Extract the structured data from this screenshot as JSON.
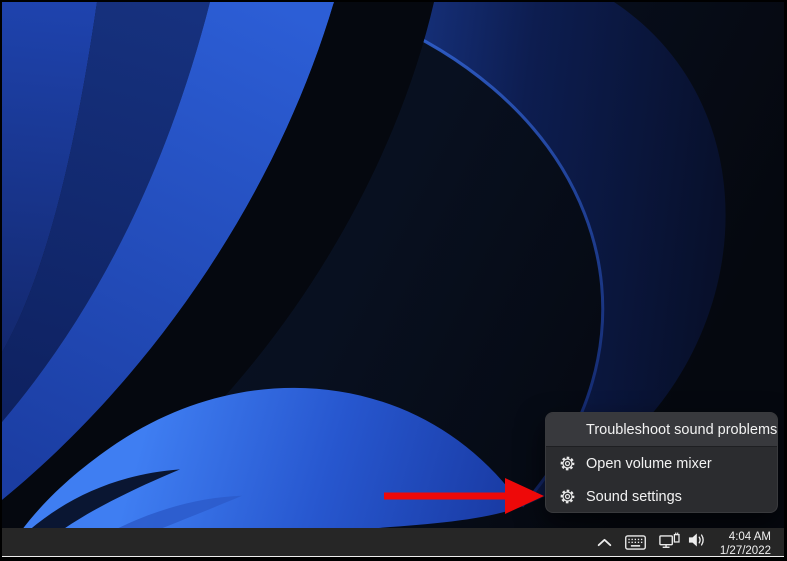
{
  "context_menu": {
    "items": [
      {
        "label": "Troubleshoot sound problems",
        "icon": null,
        "state": "highlighted"
      },
      {
        "label": "Open volume mixer",
        "icon": "gear-icon",
        "state": "normal"
      },
      {
        "label": "Sound settings",
        "icon": "gear-icon",
        "state": "normal"
      }
    ]
  },
  "taskbar": {
    "tray_icons": [
      "chevron-up-icon",
      "touch-keyboard-icon",
      "ethernet-network-icon",
      "speaker-volume-icon"
    ],
    "clock": {
      "time": "4:04 AM",
      "date": "1/27/2022"
    }
  },
  "annotation": {
    "type": "arrow",
    "color": "#ee0909",
    "points_to": "Sound settings"
  },
  "wallpaper": {
    "description": "Windows 11 dark blue bloom abstract ribbons"
  },
  "colors": {
    "menu_bg": "#2b2c2f",
    "menu_highlight": "#38393d",
    "taskbar_bg": "#262626",
    "text": "#f2f2f2",
    "arrow_red": "#ee0909"
  }
}
